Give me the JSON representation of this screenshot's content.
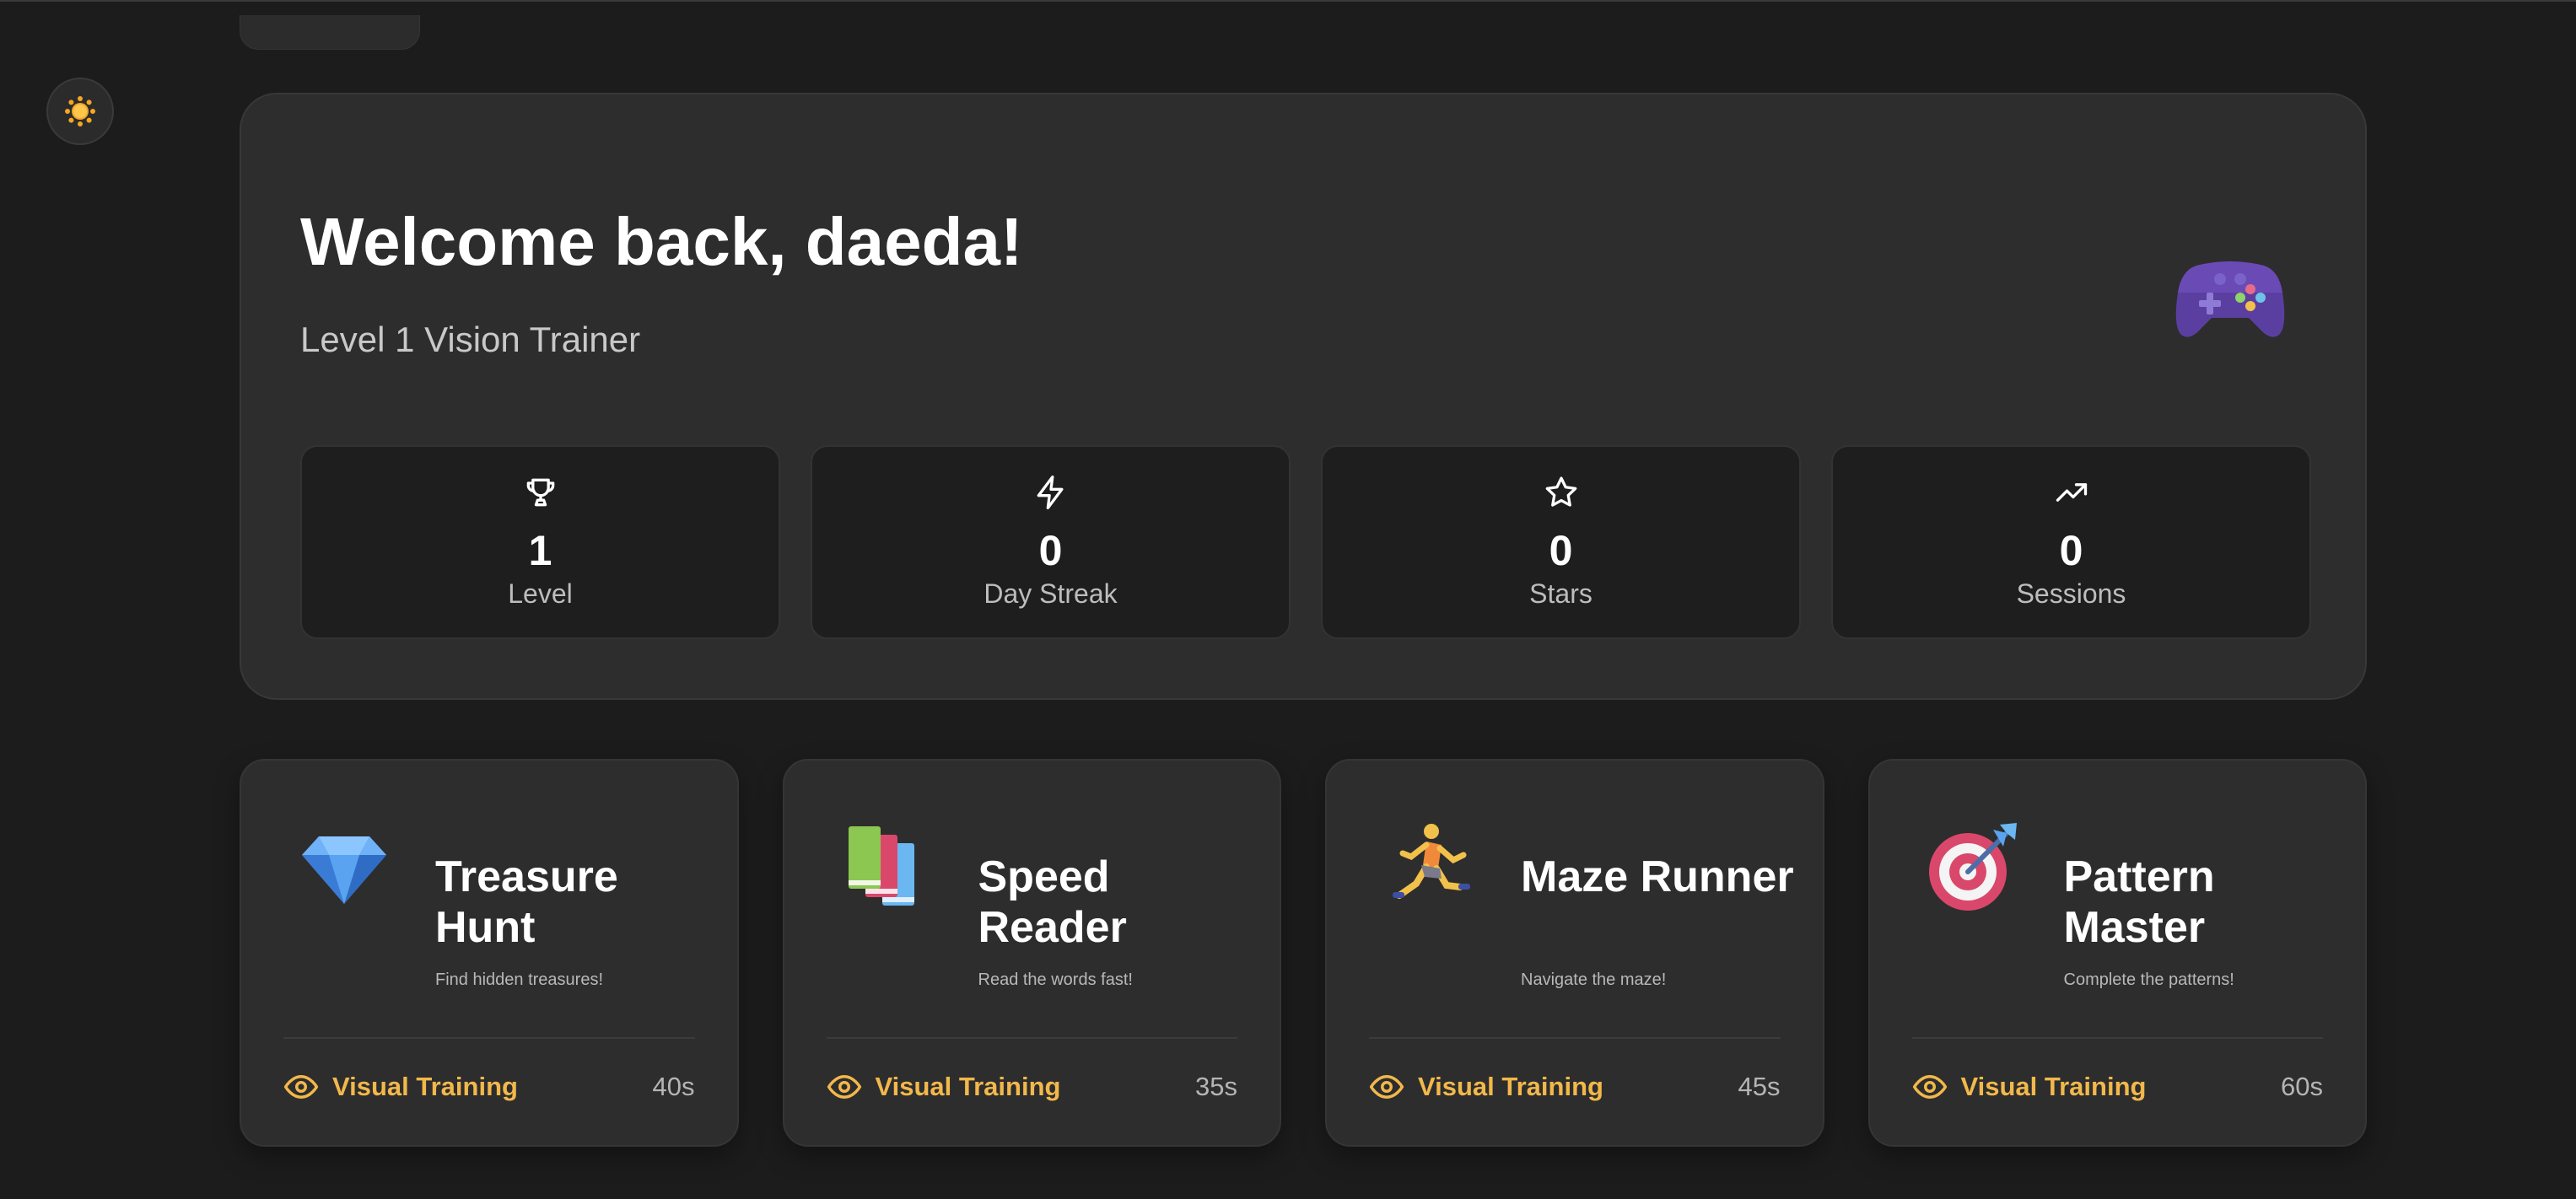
{
  "header": {
    "theme_toggle_icon": "sun-icon"
  },
  "hero": {
    "title": "Welcome back, daeda!",
    "subtitle": "Level 1 Vision Trainer",
    "emoji": "game-controller-emoji"
  },
  "stats": [
    {
      "icon": "trophy-icon",
      "value": "1",
      "label": "Level"
    },
    {
      "icon": "lightning-icon",
      "value": "0",
      "label": "Day Streak"
    },
    {
      "icon": "star-icon",
      "value": "0",
      "label": "Stars"
    },
    {
      "icon": "trending-up-icon",
      "value": "0",
      "label": "Sessions"
    }
  ],
  "games": [
    {
      "emoji": "gem-emoji",
      "title": "Treasure Hunt",
      "description": "Find hidden treasures!",
      "category": "Visual Training",
      "duration": "40s"
    },
    {
      "emoji": "books-emoji",
      "title": "Speed Reader",
      "description": "Read the words fast!",
      "category": "Visual Training",
      "duration": "35s"
    },
    {
      "emoji": "runner-emoji",
      "title": "Maze Runner",
      "description": "Navigate the maze!",
      "category": "Visual Training",
      "duration": "45s"
    },
    {
      "emoji": "target-emoji",
      "title": "Pattern Master",
      "description": "Complete the patterns!",
      "category": "Visual Training",
      "duration": "60s"
    }
  ],
  "colors": {
    "background": "#1c1c1c",
    "card": "#2d2d2d",
    "stat_card": "#1e1e1e",
    "accent": "#f2b84b"
  }
}
